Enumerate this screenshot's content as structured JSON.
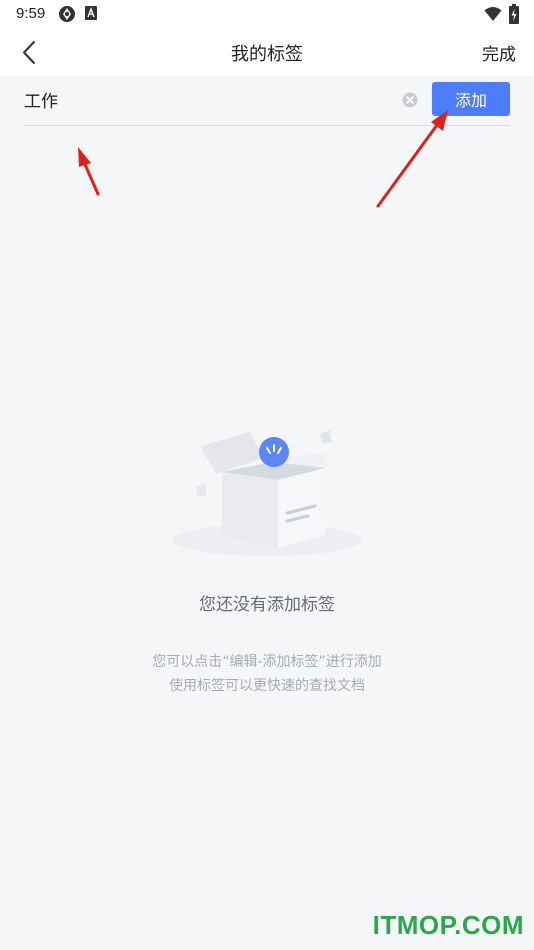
{
  "status_bar": {
    "time": "9:59",
    "icons": [
      "sync-icon",
      "a-badge-icon",
      "wifi-icon",
      "battery-icon"
    ]
  },
  "nav": {
    "back_icon": "chevron-left-icon",
    "title": "我的标签",
    "done_label": "完成"
  },
  "tag_input": {
    "value": "工作",
    "placeholder": "",
    "clear_icon": "clear-circle-icon"
  },
  "add_button": {
    "label": "添加",
    "color": "#4d7cfe"
  },
  "empty_state": {
    "illustration": "open-box-icon",
    "title": "您还没有添加标签",
    "hint_line1": "您可以点击“编辑-添加标签”进行添加",
    "hint_line2": "使用标签可以更快速的查找文档"
  },
  "annotations": {
    "arrow_color": "#e0201c"
  },
  "watermark": {
    "text": "ITMOP.COM",
    "color": "#2aa84a"
  }
}
